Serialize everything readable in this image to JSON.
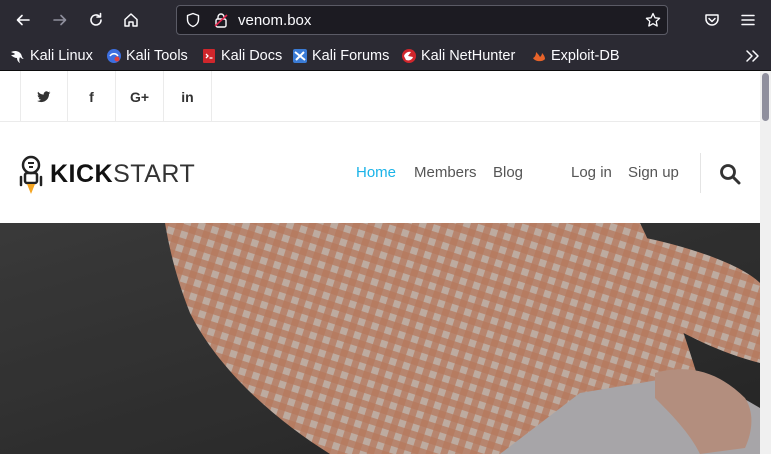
{
  "browser": {
    "url": "venom.box",
    "bookmarks": [
      {
        "label": "Kali Linux",
        "icon": "kali-dragon-icon"
      },
      {
        "label": "Kali Tools",
        "icon": "kali-tools-icon"
      },
      {
        "label": "Kali Docs",
        "icon": "kali-docs-icon"
      },
      {
        "label": "Kali Forums",
        "icon": "kali-forums-icon"
      },
      {
        "label": "Kali NetHunter",
        "icon": "kali-nethunter-icon"
      },
      {
        "label": "Exploit-DB",
        "icon": "exploit-db-icon"
      }
    ]
  },
  "site": {
    "social": [
      {
        "label": "",
        "icon": "twitter-icon"
      },
      {
        "label": "f",
        "icon": "facebook-icon"
      },
      {
        "label": "G+",
        "icon": "google-plus-icon"
      },
      {
        "label": "in",
        "icon": "linkedin-icon"
      }
    ],
    "brand_bold": "KICK",
    "brand_light": "START",
    "nav": {
      "home": "Home",
      "members": "Members",
      "blog": "Blog",
      "login": "Log in",
      "signup": "Sign up"
    },
    "accent_color": "#1ab3e8"
  }
}
